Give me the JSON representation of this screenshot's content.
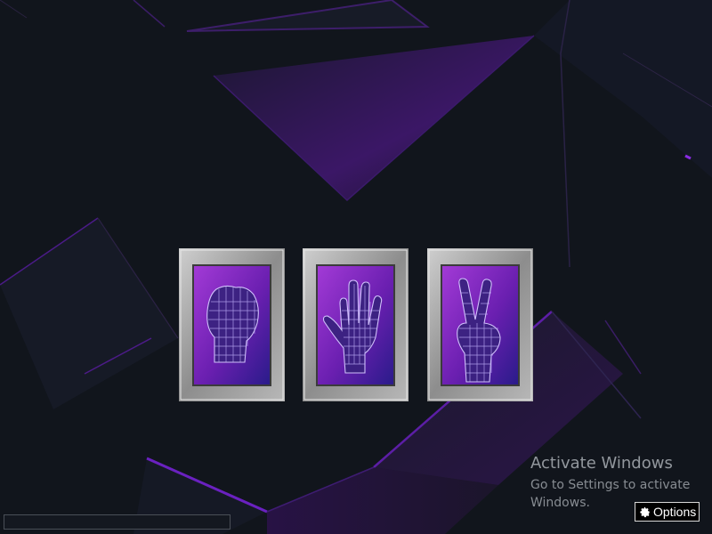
{
  "game": {
    "choices": [
      {
        "id": "rock",
        "icon": "fist-icon"
      },
      {
        "id": "paper",
        "icon": "open-hand-icon"
      },
      {
        "id": "scissors",
        "icon": "peace-hand-icon"
      }
    ]
  },
  "watermark": {
    "title": "Activate Windows",
    "subtitle": "Go to Settings to activate Windows."
  },
  "options_button": {
    "label": "Options",
    "icon": "gear-icon"
  },
  "colors": {
    "background": "#11151c",
    "accent_purple": "#7a1fc4",
    "card_frame": "#9a9a9a",
    "card_inner": "#7b1fa2"
  }
}
